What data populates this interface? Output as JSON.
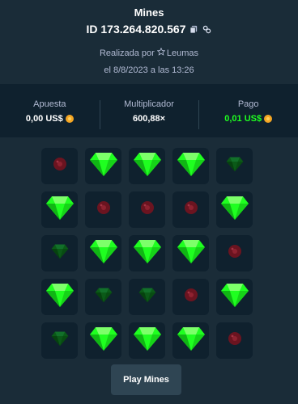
{
  "header": {
    "title": "Mines",
    "bet_id": "ID 173.264.820.567",
    "placed_by_prefix": "Realizada por",
    "username": "Leumas",
    "date_text": "el 8/8/2023 a las 13:26"
  },
  "stats": {
    "bet_label": "Apuesta",
    "bet_value": "0,00 US$",
    "multiplier_label": "Multiplicador",
    "multiplier_value": "600,88×",
    "payout_label": "Pago",
    "payout_value": "0,01 US$"
  },
  "grid": {
    "tiles": [
      "mine",
      "gem",
      "gem",
      "gem",
      "gem-dim",
      "gem",
      "mine",
      "mine",
      "mine",
      "gem",
      "gem-dim",
      "gem",
      "gem",
      "gem",
      "mine",
      "gem",
      "gem-dim",
      "gem-dim",
      "mine",
      "gem",
      "gem-dim",
      "gem",
      "gem",
      "gem",
      "mine"
    ]
  },
  "actions": {
    "play_label": "Play Mines"
  },
  "colors": {
    "background": "#1a2c38",
    "panel": "#0f212e",
    "gem": "#1fff20",
    "gem_dim": "#0b5a18",
    "mine": "#6b1420",
    "payout": "#1fff20"
  }
}
